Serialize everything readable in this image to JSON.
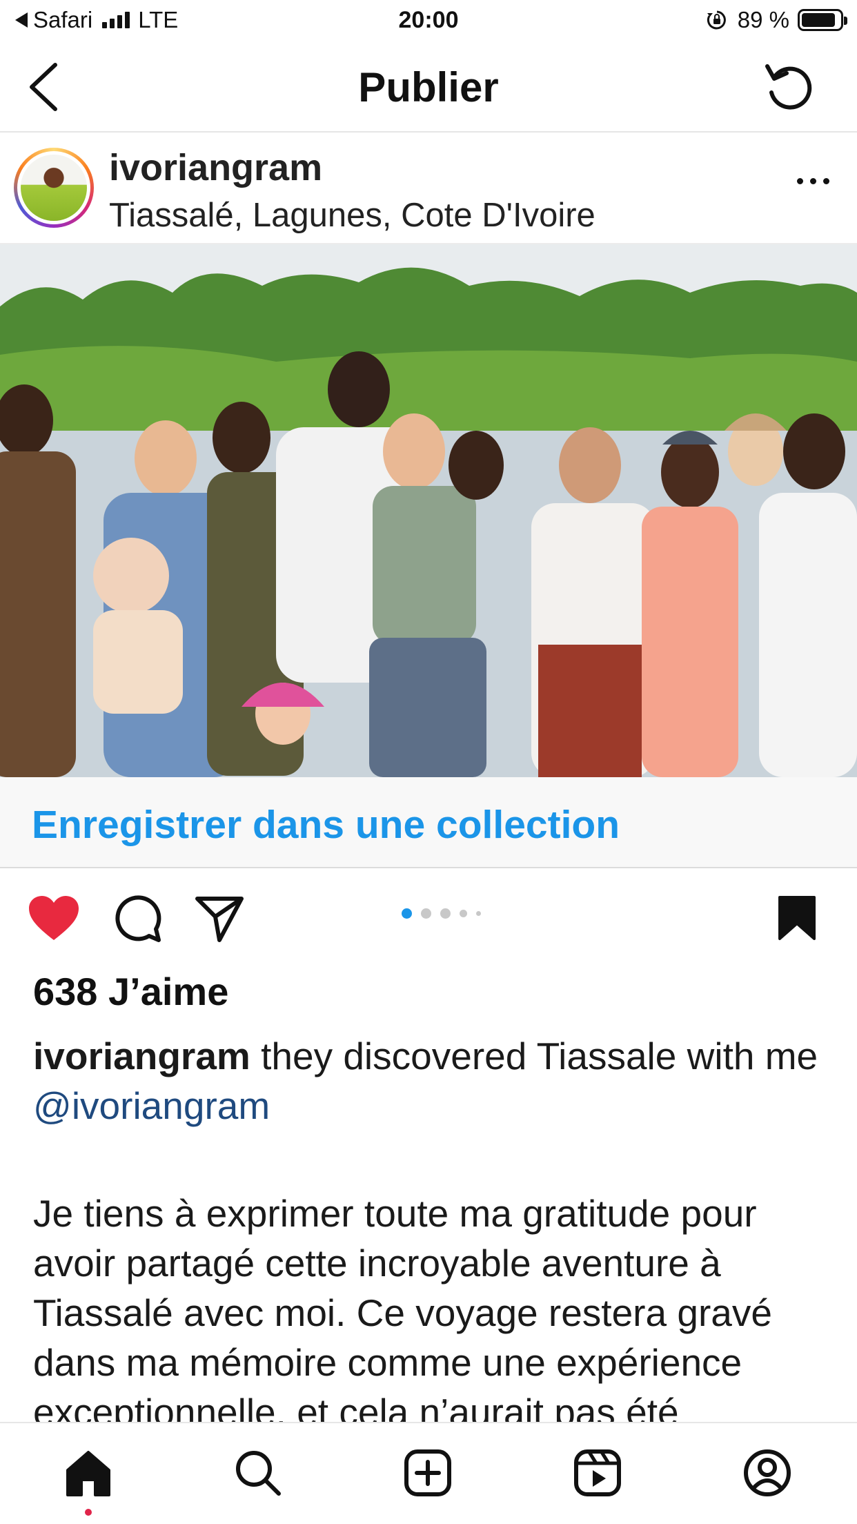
{
  "status_bar": {
    "back_app": "Safari",
    "network": "LTE",
    "time": "20:00",
    "battery": "89 %",
    "battery_level": 0.89
  },
  "nav": {
    "title": "Publier",
    "back_icon": "chevron-left-icon",
    "right_icon": "undo-icon"
  },
  "post": {
    "username": "ivoriangram",
    "location": "Tiassalé, Lagunes, Cote D'Ivoire",
    "more_icon": "more-horizontal-icon"
  },
  "collection": {
    "label": "Enregistrer dans une collection"
  },
  "actions": {
    "liked": true,
    "saved": true,
    "carousel_pages": 5,
    "carousel_active": 1,
    "icons": [
      "heart-icon",
      "comment-icon",
      "share-icon",
      "bookmark-icon"
    ]
  },
  "likes_text": "638 J’aime",
  "caption": {
    "user": "ivoriangram",
    "text": " they discovered Tiassale with me ",
    "mention": "@ivoriangram"
  },
  "body": {
    "text": "Je tiens à exprimer toute ma gratitude pour avoir partagé cette incroyable aventure à Tiassalé avec moi. Ce voyage restera gravé dans ma mémoire comme une expérience exceptionnelle, et cela n’aurait pas été"
  },
  "tabbar": {
    "items": [
      "home-icon",
      "search-icon",
      "create-icon",
      "reels-icon",
      "profile-icon"
    ],
    "accent": "#e0244a"
  },
  "colors": {
    "link_blue": "#1b95e8",
    "mention_blue": "#1f4a7f",
    "like_red": "#e8293f",
    "carousel_active": "#1b95e8"
  }
}
